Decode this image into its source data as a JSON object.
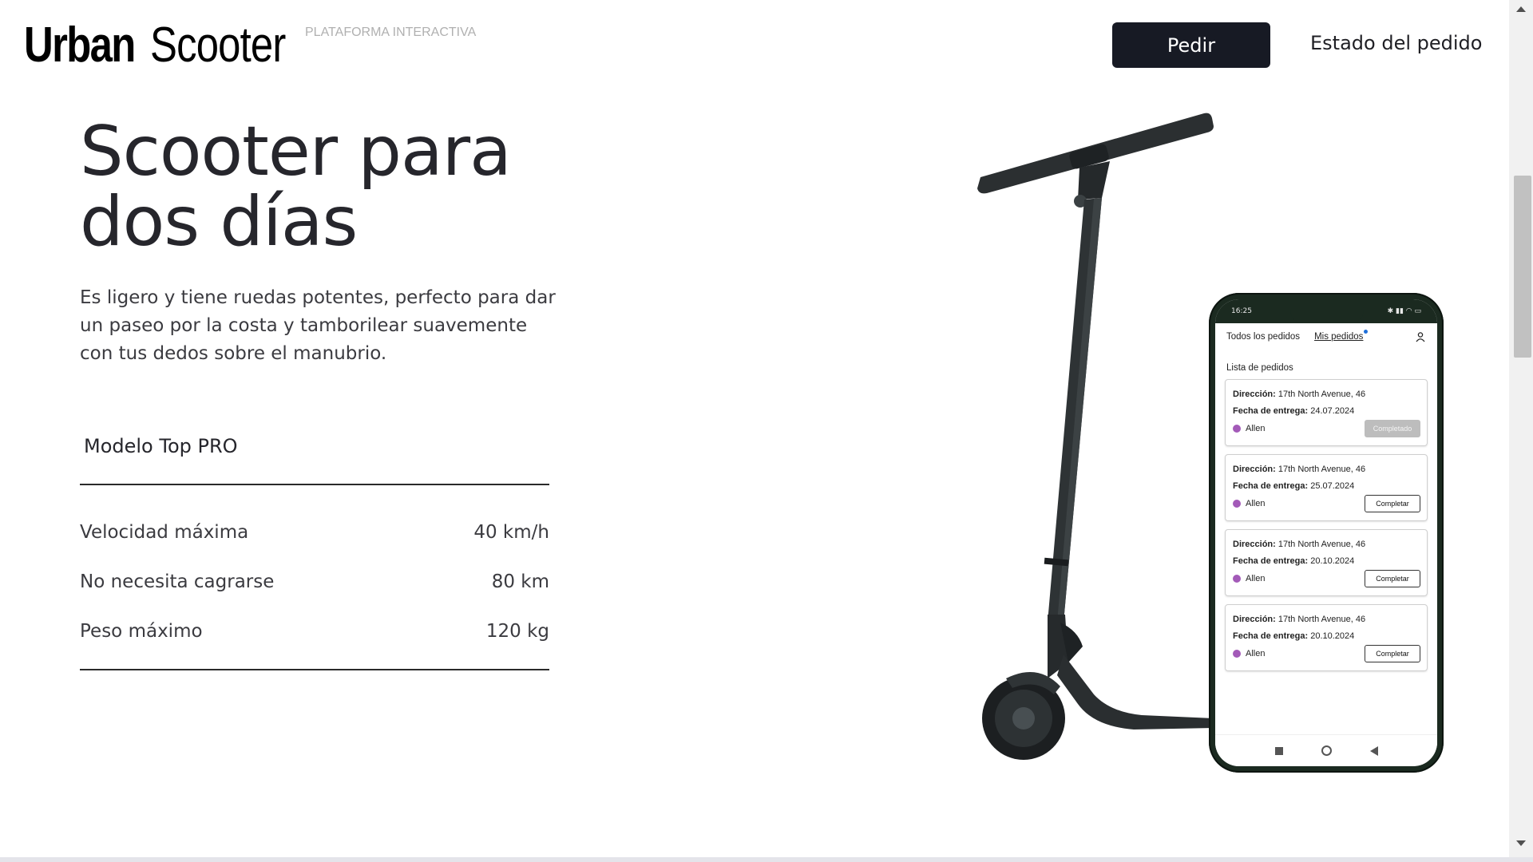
{
  "header": {
    "logo_urban": "Urban",
    "logo_scooter": "Scooter",
    "logo_tag": "PLATAFORMA INTERACTIVA",
    "order_button": "Pedir",
    "status_link": "Estado del pedido"
  },
  "hero": {
    "title": "Scooter para dos días",
    "description": "Es ligero y tiene ruedas potentes, perfecto para dar un paseo por la costa y tamborilear suavemente con tus dedos sobre el manubrio."
  },
  "specs": {
    "model": "Modelo Top PRO",
    "rows": [
      {
        "label": "Velocidad máxima",
        "value": "40 km/h"
      },
      {
        "label": "No necesita cagrarse",
        "value": "80 km"
      },
      {
        "label": "Peso máximo",
        "value": "120 kg"
      }
    ]
  },
  "phone": {
    "time": "16:25",
    "tabs": [
      "Todos los pedidos",
      "Mis pedidos"
    ],
    "list_title": "Lista de pedidos",
    "address_label": "Dirección:",
    "date_label": "Fecha de entrega:",
    "orders": [
      {
        "address": "17th North Avenue, 46",
        "date": "24.07.2024",
        "courier": "Allen",
        "action": "Completado"
      },
      {
        "address": "17th North Avenue, 46",
        "date": "25.07.2024",
        "courier": "Allen",
        "action": "Completar"
      },
      {
        "address": "17th North Avenue, 46",
        "date": "20.10.2024",
        "courier": "Allen",
        "action": "Completar"
      },
      {
        "address": "17th North Avenue, 46",
        "date": "20.10.2024",
        "courier": "Allen",
        "action": "Completar"
      }
    ]
  },
  "colors": {
    "button_bg": "#171a24",
    "courier_dot": "#a35ab8",
    "phone_frame": "#1b2a20"
  }
}
